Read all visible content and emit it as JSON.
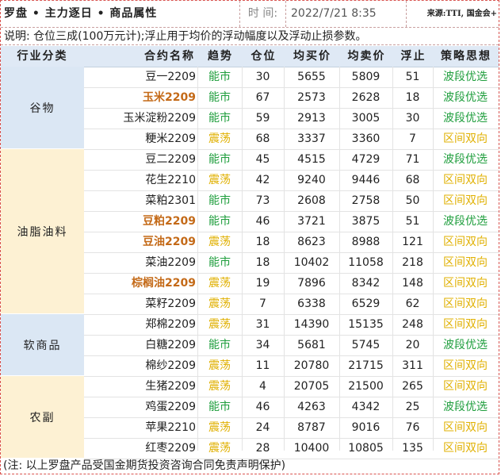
{
  "header": {
    "title": "罗盘 • 主力逐日 • 商品属性",
    "time_label": "时 间:",
    "time_value": "2022/7/21 8:35",
    "source": "来源:TTI, 国金会+"
  },
  "note": "说明: 仓位三成(100万元计);浮止用于均价的浮动幅度以及浮动止损参数。",
  "columns": [
    "行业分类",
    "合约名称",
    "趋势",
    "仓位",
    "均买价",
    "均卖价",
    "浮止",
    "策略思想"
  ],
  "colors": {
    "green": "#1f9e3d",
    "yellow": "#e0b000",
    "header_bg": "#dfe9f5",
    "cat_blue": "#dbe7f4",
    "cat_cream": "#fdf1d3",
    "highlight_name": "#c46a18"
  },
  "categories": [
    {
      "label": "谷物",
      "rows": 4,
      "color": "blue"
    },
    {
      "label": "油脂油料",
      "rows": 8,
      "color": "cream"
    },
    {
      "label": "软商品",
      "rows": 3,
      "color": "blue"
    },
    {
      "label": "农副",
      "rows": 4,
      "color": "cream"
    }
  ],
  "rows": [
    {
      "name": "豆一2209",
      "bold": false,
      "trend": "能市",
      "trend_color": "green",
      "position": "30",
      "avg_buy": "5655",
      "avg_sell": "5809",
      "float_stop": "51",
      "strategy": "波段优选",
      "strategy_color": "green"
    },
    {
      "name": "玉米2209",
      "bold": true,
      "trend": "能市",
      "trend_color": "green",
      "position": "67",
      "avg_buy": "2573",
      "avg_sell": "2628",
      "float_stop": "18",
      "strategy": "波段优选",
      "strategy_color": "green"
    },
    {
      "name": "玉米淀粉2209",
      "bold": false,
      "trend": "能市",
      "trend_color": "green",
      "position": "59",
      "avg_buy": "2913",
      "avg_sell": "3005",
      "float_stop": "30",
      "strategy": "波段优选",
      "strategy_color": "green"
    },
    {
      "name": "粳米2209",
      "bold": false,
      "trend": "震荡",
      "trend_color": "yellow",
      "position": "68",
      "avg_buy": "3337",
      "avg_sell": "3360",
      "float_stop": "7",
      "strategy": "区间双向",
      "strategy_color": "yellow"
    },
    {
      "name": "豆二2209",
      "bold": false,
      "trend": "能市",
      "trend_color": "green",
      "position": "45",
      "avg_buy": "4515",
      "avg_sell": "4729",
      "float_stop": "71",
      "strategy": "波段优选",
      "strategy_color": "green"
    },
    {
      "name": "花生2210",
      "bold": false,
      "trend": "震荡",
      "trend_color": "yellow",
      "position": "42",
      "avg_buy": "9240",
      "avg_sell": "9446",
      "float_stop": "68",
      "strategy": "区间双向",
      "strategy_color": "yellow"
    },
    {
      "name": "菜粕2301",
      "bold": false,
      "trend": "能市",
      "trend_color": "green",
      "position": "73",
      "avg_buy": "2608",
      "avg_sell": "2758",
      "float_stop": "50",
      "strategy": "区间双向",
      "strategy_color": "yellow"
    },
    {
      "name": "豆粕2209",
      "bold": true,
      "trend": "能市",
      "trend_color": "green",
      "position": "46",
      "avg_buy": "3721",
      "avg_sell": "3875",
      "float_stop": "51",
      "strategy": "波段优选",
      "strategy_color": "green"
    },
    {
      "name": "豆油2209",
      "bold": true,
      "trend": "震荡",
      "trend_color": "yellow",
      "position": "18",
      "avg_buy": "8623",
      "avg_sell": "8988",
      "float_stop": "121",
      "strategy": "区间双向",
      "strategy_color": "yellow"
    },
    {
      "name": "菜油2209",
      "bold": false,
      "trend": "能市",
      "trend_color": "green",
      "position": "18",
      "avg_buy": "10402",
      "avg_sell": "11058",
      "float_stop": "218",
      "strategy": "区间双向",
      "strategy_color": "yellow"
    },
    {
      "name": "棕榈油2209",
      "bold": true,
      "trend": "震荡",
      "trend_color": "yellow",
      "position": "19",
      "avg_buy": "7896",
      "avg_sell": "8342",
      "float_stop": "148",
      "strategy": "区间双向",
      "strategy_color": "yellow"
    },
    {
      "name": "菜籽2209",
      "bold": false,
      "trend": "震荡",
      "trend_color": "yellow",
      "position": "7",
      "avg_buy": "6338",
      "avg_sell": "6529",
      "float_stop": "62",
      "strategy": "区间双向",
      "strategy_color": "yellow"
    },
    {
      "name": "郑棉2209",
      "bold": false,
      "trend": "震荡",
      "trend_color": "yellow",
      "position": "31",
      "avg_buy": "14390",
      "avg_sell": "15135",
      "float_stop": "248",
      "strategy": "区间双向",
      "strategy_color": "yellow"
    },
    {
      "name": "白糖2209",
      "bold": false,
      "trend": "能市",
      "trend_color": "green",
      "position": "34",
      "avg_buy": "5681",
      "avg_sell": "5745",
      "float_stop": "20",
      "strategy": "波段优选",
      "strategy_color": "green"
    },
    {
      "name": "棉纱2209",
      "bold": false,
      "trend": "震荡",
      "trend_color": "yellow",
      "position": "11",
      "avg_buy": "20780",
      "avg_sell": "21715",
      "float_stop": "311",
      "strategy": "区间双向",
      "strategy_color": "yellow"
    },
    {
      "name": "生猪2209",
      "bold": false,
      "trend": "震荡",
      "trend_color": "yellow",
      "position": "4",
      "avg_buy": "20705",
      "avg_sell": "21500",
      "float_stop": "265",
      "strategy": "区间双向",
      "strategy_color": "yellow"
    },
    {
      "name": "鸡蛋2209",
      "bold": false,
      "trend": "能市",
      "trend_color": "green",
      "position": "46",
      "avg_buy": "4263",
      "avg_sell": "4342",
      "float_stop": "25",
      "strategy": "波段优选",
      "strategy_color": "green"
    },
    {
      "name": "苹果2210",
      "bold": false,
      "trend": "震荡",
      "trend_color": "yellow",
      "position": "24",
      "avg_buy": "8787",
      "avg_sell": "9016",
      "float_stop": "76",
      "strategy": "区间双向",
      "strategy_color": "yellow"
    },
    {
      "name": "红枣2209",
      "bold": false,
      "trend": "震荡",
      "trend_color": "yellow",
      "position": "28",
      "avg_buy": "10400",
      "avg_sell": "10805",
      "float_stop": "135",
      "strategy": "区间双向",
      "strategy_color": "yellow"
    }
  ],
  "footer": "(注: 以上罗盘产品受国金期货投资咨询合同免责声明保护)"
}
